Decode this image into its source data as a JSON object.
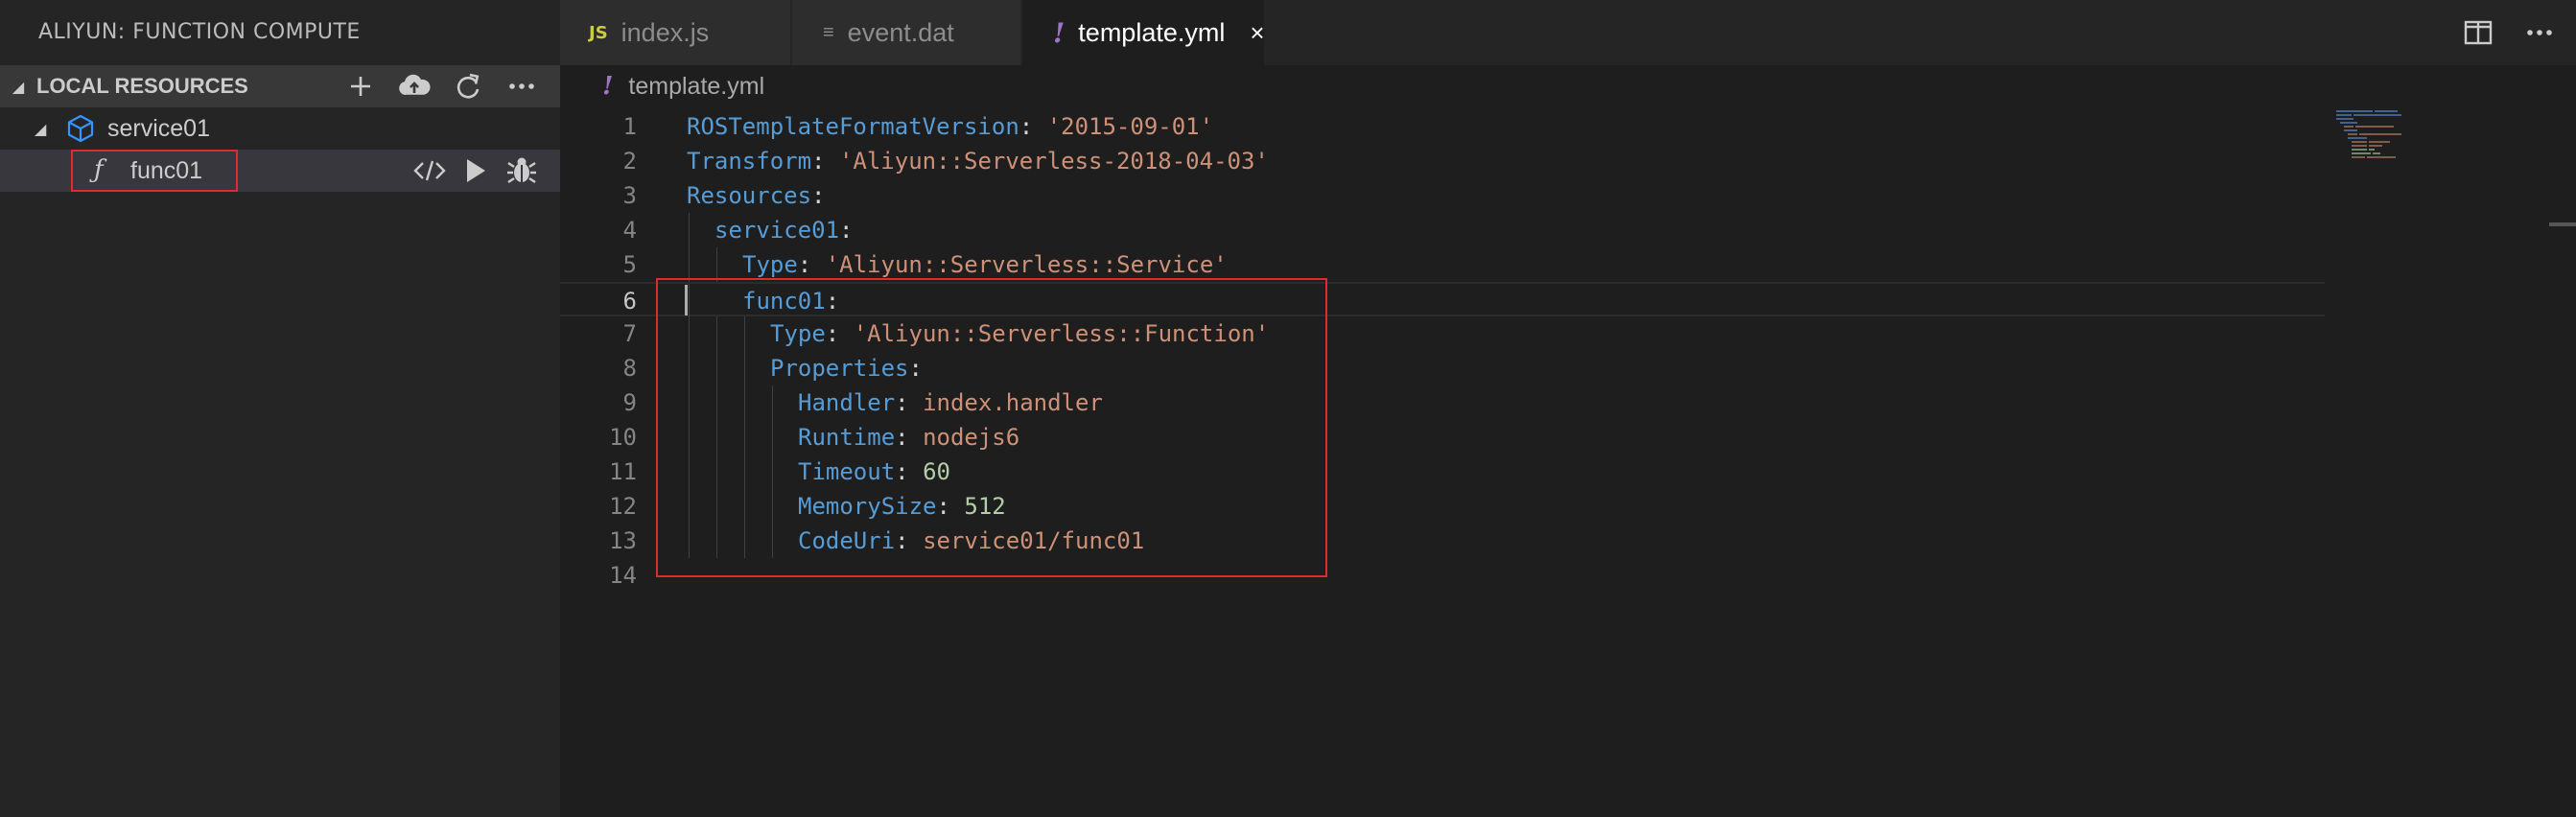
{
  "sidebar": {
    "title": "ALIYUN: FUNCTION COMPUTE",
    "section": {
      "label": "LOCAL RESOURCES",
      "actions": [
        "add-icon",
        "cloud-upload-icon",
        "refresh-icon",
        "more-icon"
      ]
    },
    "tree": {
      "service": {
        "label": "service01",
        "icon": "cube-icon"
      },
      "function": {
        "label": "func01",
        "icon": "function-icon",
        "actions": [
          "code-icon",
          "run-icon",
          "debug-icon"
        ]
      }
    }
  },
  "tabs": [
    {
      "icon_label": "JS",
      "label": "index.js",
      "active": false
    },
    {
      "icon_label": "≡",
      "label": "event.dat",
      "active": false
    },
    {
      "icon_label": "!",
      "label": "template.yml",
      "active": true,
      "close": "×"
    }
  ],
  "breadcrumb": {
    "icon_label": "!",
    "file": "template.yml"
  },
  "editor": {
    "current_line": 6,
    "lines": [
      {
        "num": "1",
        "key": "ROSTemplateFormatVersion",
        "value": "'2015-09-01'",
        "value_type": "string"
      },
      {
        "num": "2",
        "key": "Transform",
        "value": "'Aliyun::Serverless-2018-04-03'",
        "value_type": "string"
      },
      {
        "num": "3",
        "key": "Resources",
        "value": "",
        "value_type": "none"
      },
      {
        "num": "4",
        "key": "service01",
        "value": "",
        "value_type": "none"
      },
      {
        "num": "5",
        "key": "Type",
        "value": "'Aliyun::Serverless::Service'",
        "value_type": "string"
      },
      {
        "num": "6",
        "key": "func01",
        "value": "",
        "value_type": "none"
      },
      {
        "num": "7",
        "key": "Type",
        "value": "'Aliyun::Serverless::Function'",
        "value_type": "string"
      },
      {
        "num": "8",
        "key": "Properties",
        "value": "",
        "value_type": "none"
      },
      {
        "num": "9",
        "key": "Handler",
        "value": "index.handler",
        "value_type": "string"
      },
      {
        "num": "10",
        "key": "Runtime",
        "value": "nodejs6",
        "value_type": "string"
      },
      {
        "num": "11",
        "key": "Timeout",
        "value": "60",
        "value_type": "number"
      },
      {
        "num": "12",
        "key": "MemorySize",
        "value": "512",
        "value_type": "number"
      },
      {
        "num": "13",
        "key": "CodeUri",
        "value": "service01/func01",
        "value_type": "string"
      },
      {
        "num": "14",
        "key": "",
        "value": "",
        "value_type": "none"
      }
    ]
  },
  "colors": {
    "key": "#569cd6",
    "string": "#ce9178",
    "number": "#b5cea8",
    "highlight": "#e02b2b"
  }
}
